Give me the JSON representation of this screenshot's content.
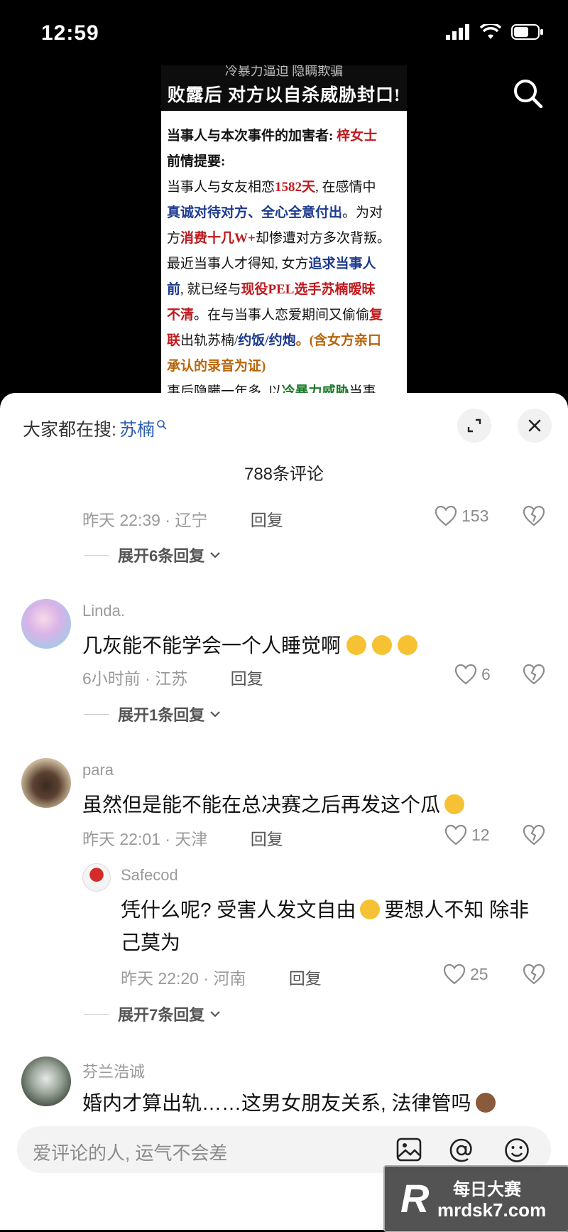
{
  "status_bar": {
    "time": "12:59"
  },
  "video_preview": {
    "banner_top": "冷暴力逼迫 隐瞒欺骗",
    "banner_main": "败露后 对方以自杀威胁封口!",
    "lines": [
      [
        {
          "t": "当事人与本次事件的加害者: ",
          "c": "b"
        },
        {
          "t": "梓女士",
          "c": "red"
        }
      ],
      [
        {
          "t": "前情提要:",
          "c": "b"
        }
      ],
      [
        {
          "t": " 当事人与女友相恋",
          "c": ""
        },
        {
          "t": "1582天",
          "c": "red"
        },
        {
          "t": ", 在感情中",
          "c": ""
        }
      ],
      [
        {
          "t": "真诚对待对方、全心全意付出",
          "c": "blue"
        },
        {
          "t": "。为对",
          "c": ""
        }
      ],
      [
        {
          "t": "方",
          "c": ""
        },
        {
          "t": "消费十几W+",
          "c": "red"
        },
        {
          "t": "却惨遭对方多次背叛。",
          "c": ""
        }
      ],
      [
        {
          "t": " 最近当事人才得知, 女方",
          "c": ""
        },
        {
          "t": "追求当事人",
          "c": "blue"
        }
      ],
      [
        {
          "t": "前",
          "c": "blue"
        },
        {
          "t": ", 就已经与",
          "c": ""
        },
        {
          "t": "现役PEL选手苏楠暧昧",
          "c": "red"
        }
      ],
      [
        {
          "t": "不清",
          "c": "red"
        },
        {
          "t": "。在与当事人恋爱期间又偷偷",
          "c": ""
        },
        {
          "t": "复",
          "c": "red"
        }
      ],
      [
        {
          "t": "联",
          "c": "red"
        },
        {
          "t": "出轨苏楠/",
          "c": ""
        },
        {
          "t": "约饭/约炮",
          "c": "blue"
        },
        {
          "t": "。(含女方亲口",
          "c": "orange"
        }
      ],
      [
        {
          "t": "承认的录音为证)",
          "c": "orange"
        }
      ],
      [
        {
          "t": " 事后隐瞒一年多, 以",
          "c": ""
        },
        {
          "t": "冷暴力威胁",
          "c": "green"
        },
        {
          "t": "当事",
          "c": ""
        }
      ]
    ]
  },
  "sheet": {
    "hot_search_label": "大家都在搜: ",
    "hot_search_term": "苏楠",
    "comment_count_title": "788条评论",
    "reply_label": "回复"
  },
  "comments": [
    {
      "id": "c0",
      "meta": "昨天 22:39 · 辽宁",
      "likes": "153",
      "expand": "展开6条回复"
    },
    {
      "id": "c1",
      "user": "Linda.",
      "text": "几灰能不能学会一个人睡觉啊",
      "meta": "6小时前 · 江苏",
      "likes": "6",
      "expand": "展开1条回复"
    },
    {
      "id": "c2",
      "user": "para",
      "text": "虽然但是能不能在总决赛之后再发这个瓜",
      "meta": "昨天 22:01 · 天津",
      "likes": "12"
    },
    {
      "id": "r1",
      "user": "Safecod",
      "text_line1": "凭什么呢? 受害人发文自由",
      "text_line1b": "要想人不知 除非",
      "text_line2": "己莫为",
      "meta": "昨天 22:20 · 河南",
      "likes": "25",
      "expand": "展开7条回复"
    },
    {
      "id": "c3",
      "user": "芬兰浩诚",
      "text": "婚内才算出轨……这男女朋友关系, 法律管吗"
    }
  ],
  "input_bar": {
    "placeholder": "爱评论的人, 运气不会差"
  },
  "watermark": {
    "logo": "R",
    "cn": "每日大赛",
    "url": "mrdsk7.com"
  }
}
